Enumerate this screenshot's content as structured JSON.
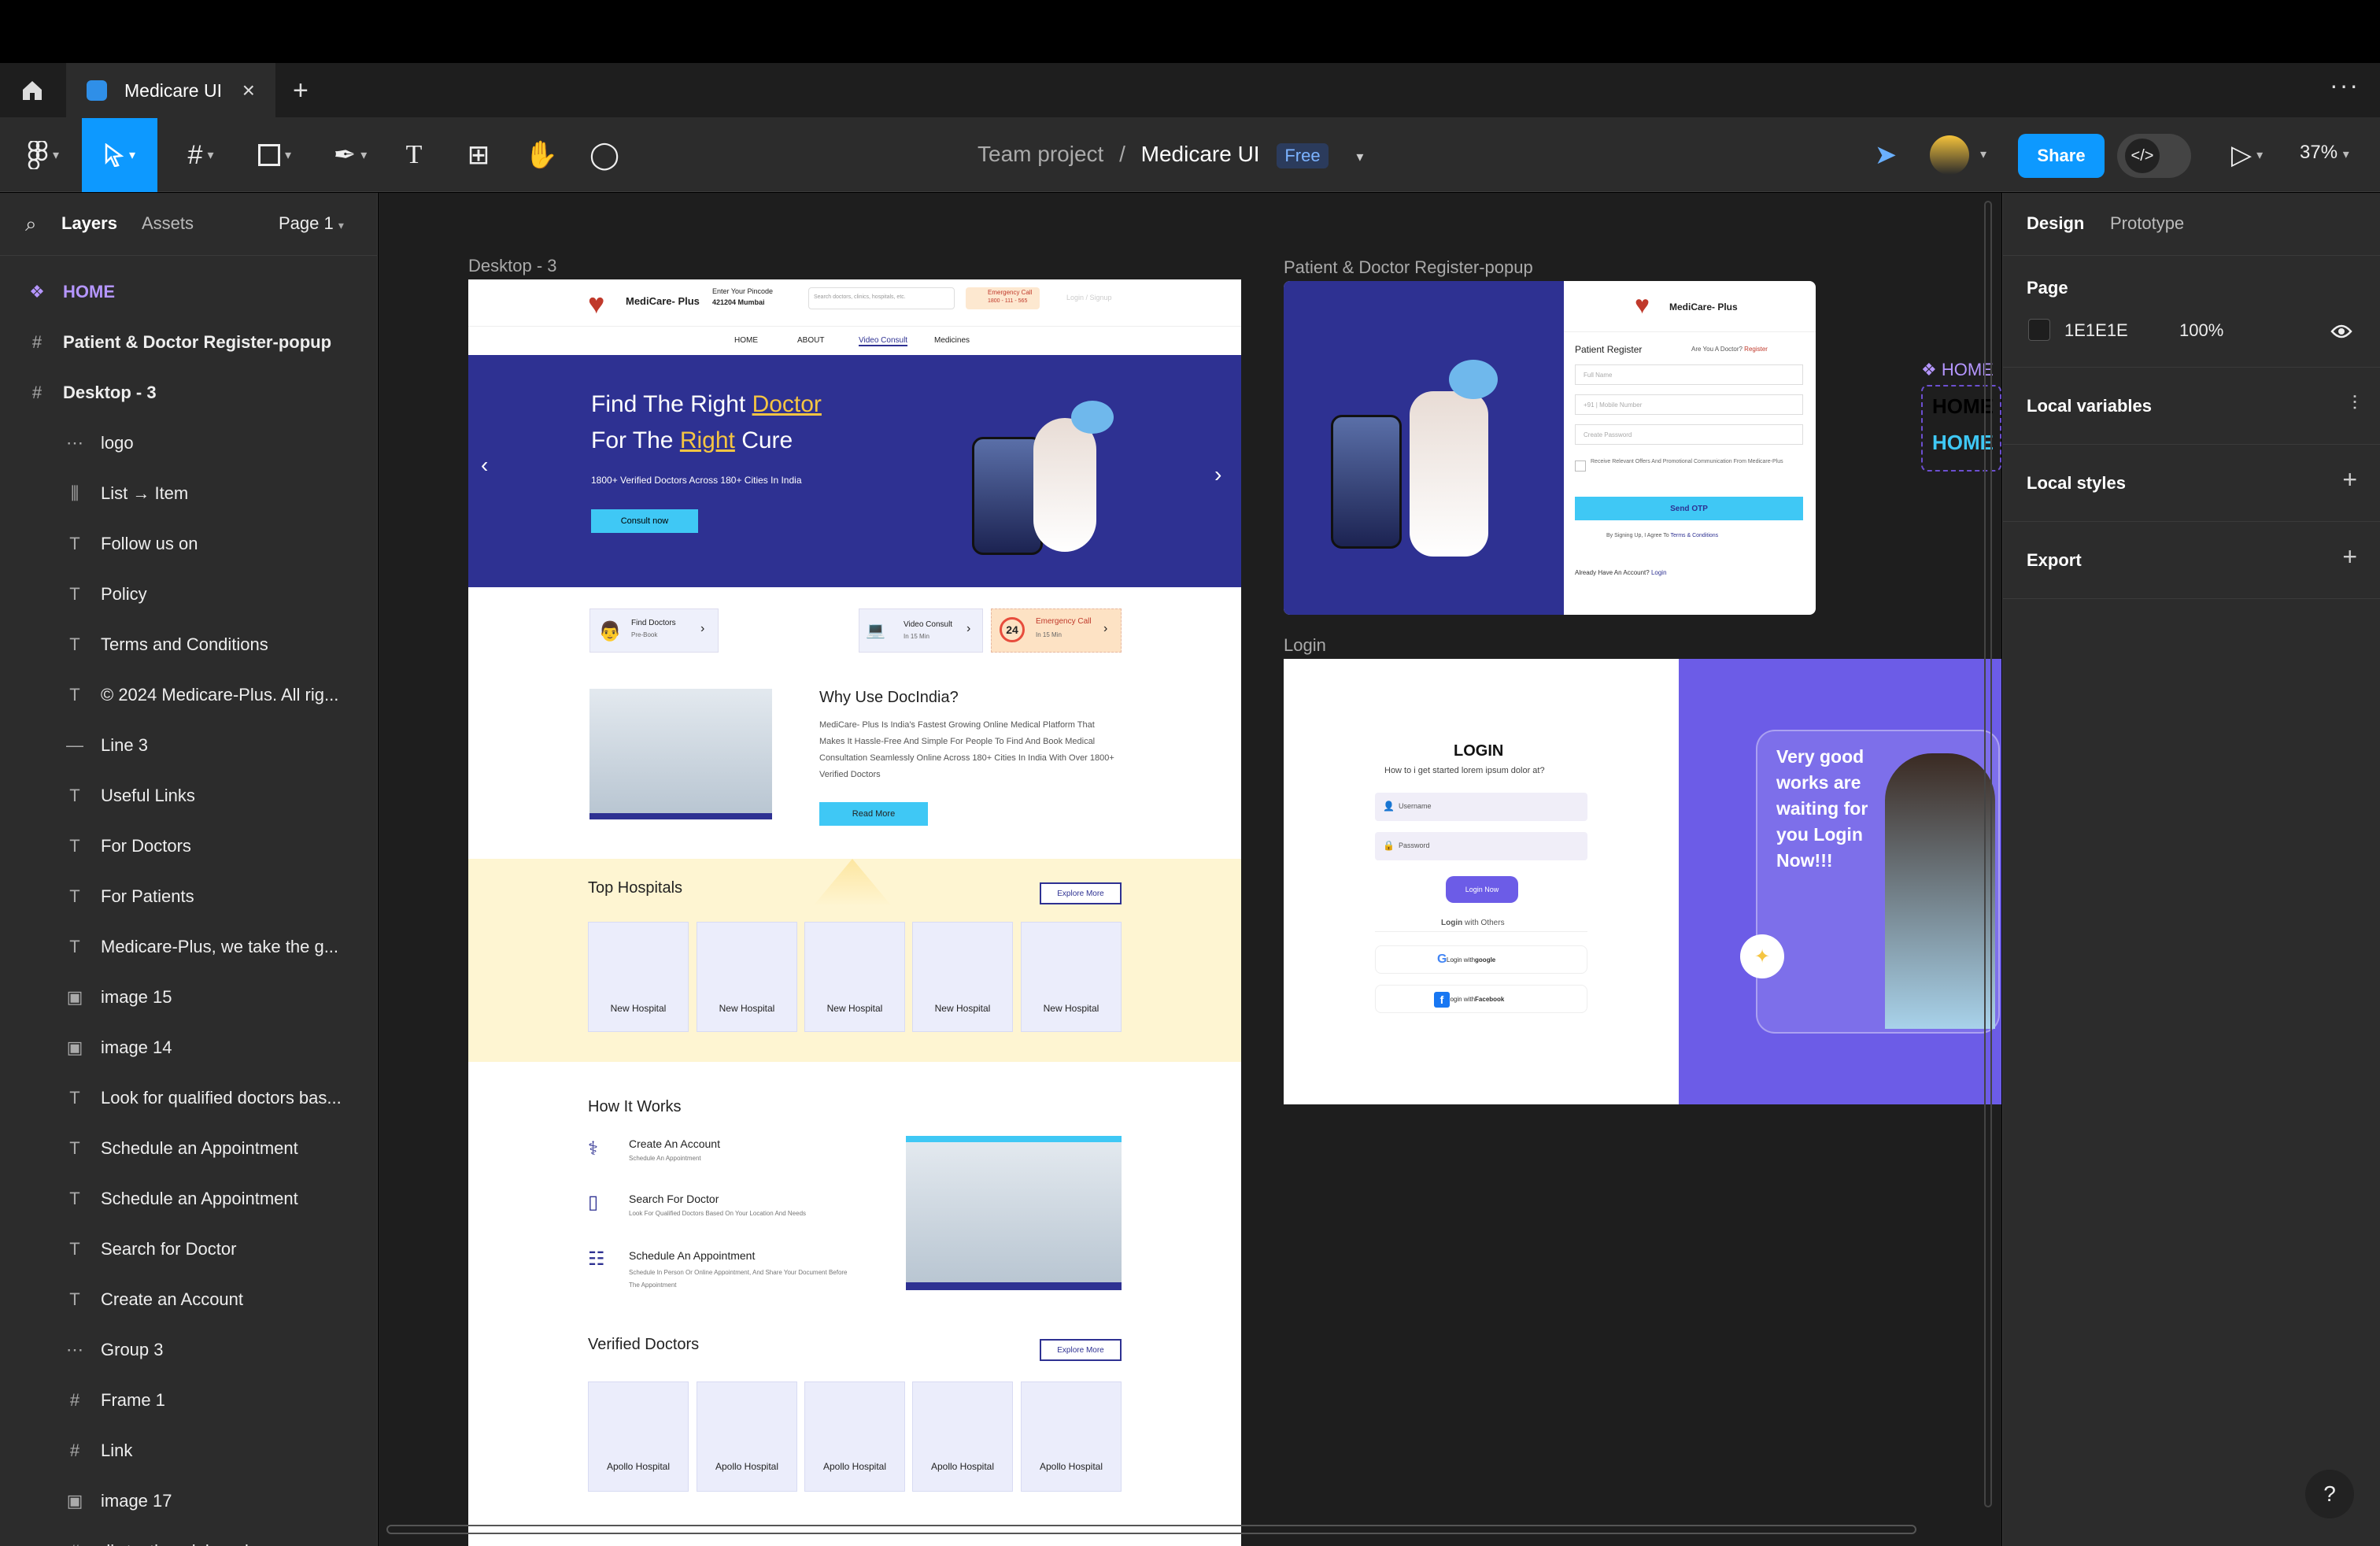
{
  "tab": {
    "file_name": "Medicare UI",
    "close": "×",
    "new": "+",
    "more": "···"
  },
  "toolbar": {
    "breadcrumb_team": "Team project",
    "breadcrumb_sep": "/",
    "breadcrumb_file": "Medicare UI",
    "plan_badge": "Free",
    "share": "Share",
    "zoom": "37%"
  },
  "left_panel": {
    "tab_layers": "Layers",
    "tab_assets": "Assets",
    "page_select": "Page 1",
    "layers": [
      {
        "icon": "component-icon",
        "label": "HOME",
        "indent": false
      },
      {
        "icon": "frame-icon",
        "label": "Patient & Doctor Register-popup",
        "indent": false
      },
      {
        "icon": "frame-icon",
        "label": "Desktop - 3",
        "indent": false
      },
      {
        "icon": "group-icon",
        "label": "logo",
        "indent": true
      },
      {
        "icon": "autolayout-icon",
        "label": "List → Item",
        "indent": true
      },
      {
        "icon": "text-icon",
        "label": "Follow us on",
        "indent": true
      },
      {
        "icon": "text-icon",
        "label": " Policy",
        "indent": true
      },
      {
        "icon": "text-icon",
        "label": "Terms and Conditions",
        "indent": true
      },
      {
        "icon": "text-icon",
        "label": "© 2024 Medicare-Plus. All rig...",
        "indent": true
      },
      {
        "icon": "line-icon",
        "label": "Line 3",
        "indent": true
      },
      {
        "icon": "text-icon",
        "label": "Useful Links",
        "indent": true
      },
      {
        "icon": "text-icon",
        "label": "For Doctors",
        "indent": true
      },
      {
        "icon": "text-icon",
        "label": "For Patients",
        "indent": true
      },
      {
        "icon": "text-icon",
        "label": "Medicare-Plus, we take the g...",
        "indent": true
      },
      {
        "icon": "image-icon",
        "label": "image 15",
        "indent": true
      },
      {
        "icon": "image-icon",
        "label": "image 14",
        "indent": true
      },
      {
        "icon": "text-icon",
        "label": "Look for qualified doctors bas...",
        "indent": true
      },
      {
        "icon": "text-icon",
        "label": "Schedule an Appointment",
        "indent": true
      },
      {
        "icon": "text-icon",
        "label": "Schedule an Appointment",
        "indent": true
      },
      {
        "icon": "text-icon",
        "label": "Search for Doctor",
        "indent": true
      },
      {
        "icon": "text-icon",
        "label": "Create an Account",
        "indent": true
      },
      {
        "icon": "group-icon",
        "label": "Group 3",
        "indent": true
      },
      {
        "icon": "frame-icon",
        "label": "Frame 1",
        "indent": true
      },
      {
        "icon": "frame-icon",
        "label": "Link",
        "indent": true
      },
      {
        "icon": "image-icon",
        "label": "image 17",
        "indent": true
      },
      {
        "icon": "frame-icon",
        "label": "div.testimonial-card",
        "indent": true
      }
    ]
  },
  "right_panel": {
    "tab_design": "Design",
    "tab_prototype": "Prototype",
    "page_title": "Page",
    "page_color": "1E1E1E",
    "page_opacity": "100%",
    "local_variables": "Local variables",
    "local_styles": "Local styles",
    "export": "Export",
    "help": "?"
  },
  "canvas": {
    "desktop_label": "Desktop - 3",
    "register_label": "Patient & Doctor Register-popup",
    "login_label": "Login",
    "home_label": "❖ HOME",
    "home_text": "HOME",
    "desktop": {
      "brand": "MediCare- Plus",
      "pincode_label": "Enter Your Pincode",
      "pincode_value": "421204 Mumbai",
      "search_placeholder": "Search doctors, clinics, hospitals, etc.",
      "emergency_title": "Emergency Call",
      "emergency_number": "1800 - 111 - 565",
      "login_signup": "Login / Signup",
      "nav": [
        "HOME",
        "ABOUT",
        "Video Consult",
        "Medicines"
      ],
      "hero_line1_a": "Find The Right ",
      "hero_line1_b": "Doctor",
      "hero_line2_a": "For The ",
      "hero_line2_b": "Right",
      "hero_line2_c": " Cure",
      "hero_sub": "1800+ Verified Doctors Across 180+ Cities In India",
      "hero_cta": "Consult now",
      "quick": [
        {
          "title": "Find Doctors",
          "sub": "Pre-Book"
        },
        {
          "title": "Video Consult",
          "sub": "In 15 Min"
        },
        {
          "title": "Emergency Call",
          "sub": "In 15 Min"
        }
      ],
      "why_title": "Why Use DocIndia?",
      "why_body": "MediCare- Plus Is India's Fastest Growing Online Medical Platform That Makes It Hassle-Free And Simple For People To Find And Book Medical Consultation Seamlessly Online Across 180+ Cities In India With Over 1800+ Verified Doctors",
      "read_more": "Read More",
      "top_hospitals": "Top Hospitals",
      "explore_more": "Explore More",
      "hospital_cards": [
        "New Hospital",
        "New Hospital",
        "New Hospital",
        "New Hospital",
        "New Hospital"
      ],
      "how_title": "How It Works",
      "steps": [
        {
          "title": "Create An Account",
          "sub": "Schedule An Appointment"
        },
        {
          "title": "Search For Doctor",
          "sub": "Look For Qualified Doctors Based On Your Location And Needs"
        },
        {
          "title": "Schedule An Appointment",
          "sub": "Schedule In Person Or Online Appointment, And Share Your Document Before The Appointment"
        }
      ],
      "verified_title": "Verified Doctors",
      "verified_cards": [
        "Apollo Hospital",
        "Apollo Hospital",
        "Apollo Hospital",
        "Apollo Hospital",
        "Apollo Hospital"
      ]
    },
    "register": {
      "brand": "MediCare- Plus",
      "title": "Patient Register",
      "doctor_q": "Are You A Doctor?",
      "doctor_link": "Register",
      "full_name": "Full Name",
      "mobile_prefix": "+91",
      "mobile": "Mobile Number",
      "password": "Create Password",
      "consent": "Receive Relevant Offers And Promotional Communication From Medicare-Plus",
      "send_otp": "Send OTP",
      "terms_prefix": "By Signing Up, I Agree To ",
      "terms_link": "Terms & Conditions",
      "already": "Already Have An Account? ",
      "login_link": "Login"
    },
    "login": {
      "title": "LOGIN",
      "subtitle": "How to i get started lorem ipsum dolor at?",
      "username": "Username",
      "password": "Password",
      "login_now": "Login Now",
      "others_a": "Login",
      "others_b": " with Others",
      "google_a": "Login with ",
      "google_b": "google",
      "facebook_a": "Login with ",
      "facebook_b": "Facebook",
      "promo": "Very good works are waiting for you Login Now!!!"
    }
  },
  "colors": {
    "accent": "#0d99ff",
    "hero": "#2e3192",
    "login_purple": "#6c5ce7",
    "hospital_bg": "#fef5d2"
  }
}
